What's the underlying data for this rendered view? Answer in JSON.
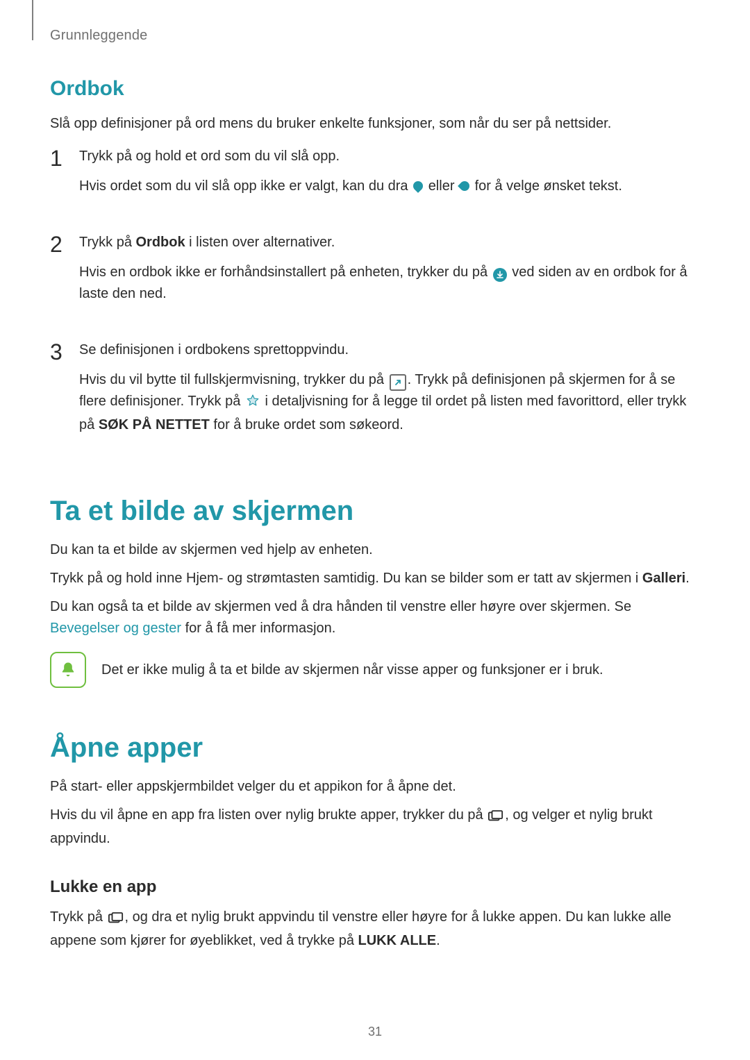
{
  "breadcrumb": "Grunnleggende",
  "section_ordbok": {
    "title": "Ordbok",
    "intro": "Slå opp definisjoner på ord mens du bruker enkelte funksjoner, som når du ser på nettsider.",
    "steps": {
      "s1": {
        "num": "1",
        "p1": "Trykk på og hold et ord som du vil slå opp.",
        "p2a": "Hvis ordet som du vil slå opp ikke er valgt, kan du dra ",
        "p2b": " eller ",
        "p2c": " for å velge ønsket tekst."
      },
      "s2": {
        "num": "2",
        "p1a": "Trykk på ",
        "p1b": "Ordbok",
        "p1c": " i listen over alternativer.",
        "p2a": "Hvis en ordbok ikke er forhåndsinstallert på enheten, trykker du på ",
        "p2b": " ved siden av en ordbok for å laste den ned."
      },
      "s3": {
        "num": "3",
        "p1": "Se definisjonen i ordbokens sprettoppvindu.",
        "p2a": "Hvis du vil bytte til fullskjermvisning, trykker du på ",
        "p2b": ". Trykk på definisjonen på skjermen for å se flere definisjoner. Trykk på ",
        "p2c": " i detaljvisning for å legge til ordet på listen med favorittord, eller trykk på ",
        "p2d": "SØK PÅ NETTET",
        "p2e": " for å bruke ordet som søkeord."
      }
    }
  },
  "section_skjerm": {
    "title": "Ta et bilde av skjermen",
    "p1": "Du kan ta et bilde av skjermen ved hjelp av enheten.",
    "p2a": "Trykk på og hold inne Hjem- og strømtasten samtidig. Du kan se bilder som er tatt av skjermen i ",
    "p2b": "Galleri",
    "p2c": ".",
    "p3a": "Du kan også ta et bilde av skjermen ved å dra hånden til venstre eller høyre over skjermen. Se ",
    "link": "Bevegelser og gester",
    "p3b": " for å få mer informasjon.",
    "note": "Det er ikke mulig å ta et bilde av skjermen når visse apper og funksjoner er i bruk."
  },
  "section_apper": {
    "title": "Åpne apper",
    "p1": "På start- eller appskjermbildet velger du et appikon for å åpne det.",
    "p2a": "Hvis du vil åpne en app fra listen over nylig brukte apper, trykker du på ",
    "p2b": ", og velger et nylig brukt appvindu.",
    "sub_title": "Lukke en app",
    "p3a": "Trykk på ",
    "p3b": ", og dra et nylig brukt appvindu til venstre eller høyre for å lukke appen. Du kan lukke alle appene som kjører for øyeblikket, ved å trykke på ",
    "p3c": "LUKK ALLE",
    "p3d": "."
  },
  "page_number": "31"
}
